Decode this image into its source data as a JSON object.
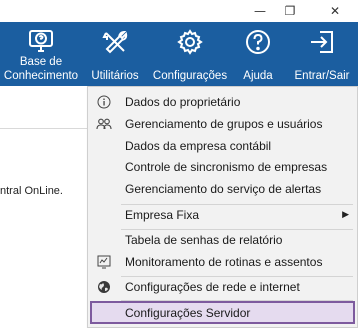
{
  "window": {
    "minimize_glyph": "—",
    "restore_glyph": "❐",
    "close_glyph": "✕"
  },
  "ribbon": {
    "buttons": [
      {
        "label_line1": "Base de",
        "label_line2": "Conhecimento",
        "icon": "monitor-question-icon"
      },
      {
        "label": "Utilitários",
        "icon": "tools-icon"
      },
      {
        "label": "Configurações",
        "icon": "gear-icon"
      },
      {
        "label": "Ajuda",
        "icon": "help-circle-icon"
      },
      {
        "label": "Entrar/Sair",
        "icon": "login-icon"
      }
    ],
    "color": "#1b5ea0"
  },
  "content": {
    "partial_text": "ntral OnLine."
  },
  "menu": {
    "items": [
      {
        "label": "Dados do proprietário",
        "icon": "info-icon"
      },
      {
        "label": "Gerenciamento de grupos e usuários",
        "icon": "users-icon"
      },
      {
        "label": "Dados da empresa contábil",
        "icon": ""
      },
      {
        "label": "Controle de sincronismo de empresas",
        "icon": ""
      },
      {
        "label": "Gerenciamento do serviço de alertas",
        "icon": ""
      },
      {
        "label": "Empresa Fixa",
        "icon": "",
        "submenu_arrow": "▶"
      },
      {
        "label": "Tabela de senhas de relatório",
        "icon": ""
      },
      {
        "label": "Monitoramento de rotinas e assentos",
        "icon": "monitor-chart-icon"
      },
      {
        "label": "Configurações de rede e internet",
        "icon": "globe-icon"
      },
      {
        "label": "Configurações Servidor",
        "icon": "",
        "selected": true
      }
    ],
    "selected_border_color": "#7d5a9e"
  }
}
